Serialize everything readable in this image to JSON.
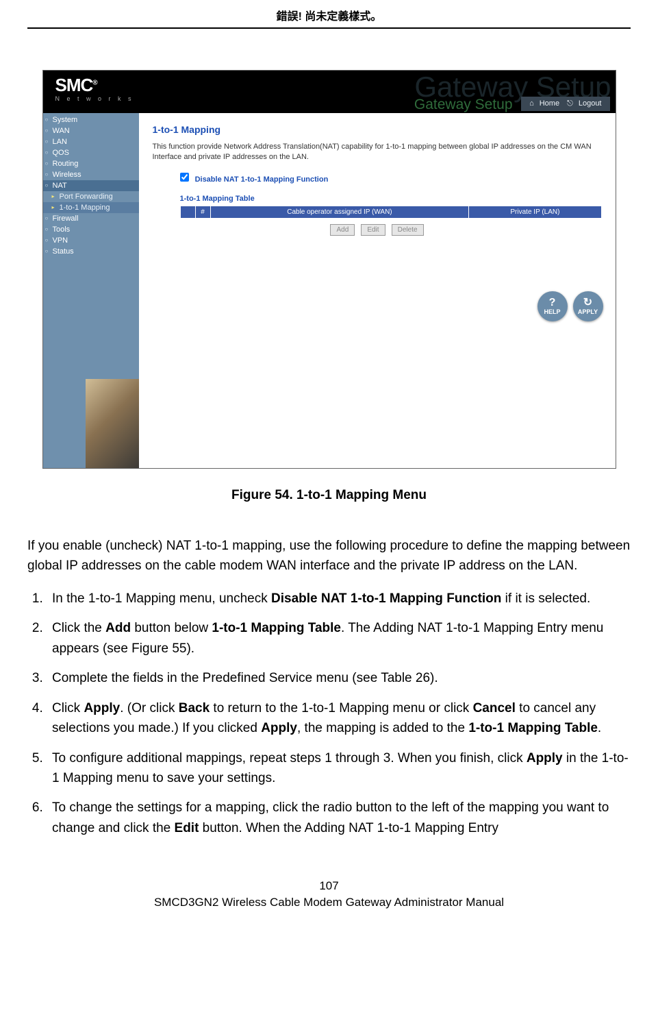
{
  "header": {
    "title": "錯誤! 尚未定義樣式。"
  },
  "screenshot": {
    "logo": "SMC",
    "logo_r": "®",
    "logo_sub": "N e t w o r k s",
    "big_title": "Gateway Setup",
    "sub_title": "Gateway Setup",
    "home": "Home",
    "logout": "Logout",
    "nav": {
      "items": [
        {
          "label": "System"
        },
        {
          "label": "WAN"
        },
        {
          "label": "LAN"
        },
        {
          "label": "QOS"
        },
        {
          "label": "Routing"
        },
        {
          "label": "Wireless"
        },
        {
          "label": "NAT",
          "active": true
        },
        {
          "label": "Firewall"
        },
        {
          "label": "Tools"
        },
        {
          "label": "VPN"
        },
        {
          "label": "Status"
        }
      ],
      "subs": [
        {
          "label": "Port Forwarding"
        },
        {
          "label": "1-to-1 Mapping",
          "active": true
        }
      ]
    },
    "content": {
      "h1": "1-to-1 Mapping",
      "desc": "This function provide Network Address Translation(NAT) capability for 1-to-1 mapping between global IP addresses on the CM WAN Interface and private IP addresses on the LAN.",
      "checkbox_label": "Disable NAT 1-to-1 Mapping Function",
      "table_label": "1-to-1 Mapping Table",
      "th_blank": " ",
      "th_num": "#",
      "th_wan": "Cable operator assigned IP (WAN)",
      "th_lan": "Private IP (LAN)",
      "btn_add": "Add",
      "btn_edit": "Edit",
      "btn_delete": "Delete",
      "help": "HELP",
      "apply": "APPLY"
    }
  },
  "figure_caption": "Figure 54. 1-to-1 Mapping Menu",
  "intro_para": "If you enable (uncheck) NAT 1-to-1 mapping, use the following procedure to define the mapping between global IP addresses on the cable modem WAN interface and the private IP address on the LAN.",
  "steps": {
    "s1_a": "In the 1-to-1 Mapping menu, uncheck ",
    "s1_b": "Disable NAT 1-to-1 Mapping Function",
    "s1_c": " if it is selected.",
    "s2_a": "Click the ",
    "s2_b": "Add",
    "s2_c": " button below ",
    "s2_d": "1-to-1 Mapping Table",
    "s2_e": ". The Adding NAT 1-to-1 Mapping Entry menu appears (see Figure 55).",
    "s3": "Complete the fields in the Predefined Service menu (see Table 26).",
    "s4_a": "Click ",
    "s4_b": "Apply",
    "s4_c": ". (Or click ",
    "s4_d": "Back",
    "s4_e": " to return to the 1-to-1 Mapping menu or click ",
    "s4_f": "Cancel",
    "s4_g": " to cancel any selections you made.) If you clicked ",
    "s4_h": "Apply",
    "s4_i": ", the mapping is added to the ",
    "s4_j": "1-to-1 Mapping Table",
    "s4_k": ".",
    "s5_a": "To configure additional mappings, repeat steps 1 through 3. When you finish, click ",
    "s5_b": "Apply",
    "s5_c": " in the 1-to-1 Mapping menu to save your settings.",
    "s6_a": "To change the settings for a mapping, click the radio button to the left of the mapping you want to change and click the ",
    "s6_b": "Edit",
    "s6_c": " button. When the Adding NAT 1-to-1 Mapping Entry"
  },
  "footer": {
    "page": "107",
    "title": "SMCD3GN2 Wireless Cable Modem Gateway Administrator Manual"
  }
}
